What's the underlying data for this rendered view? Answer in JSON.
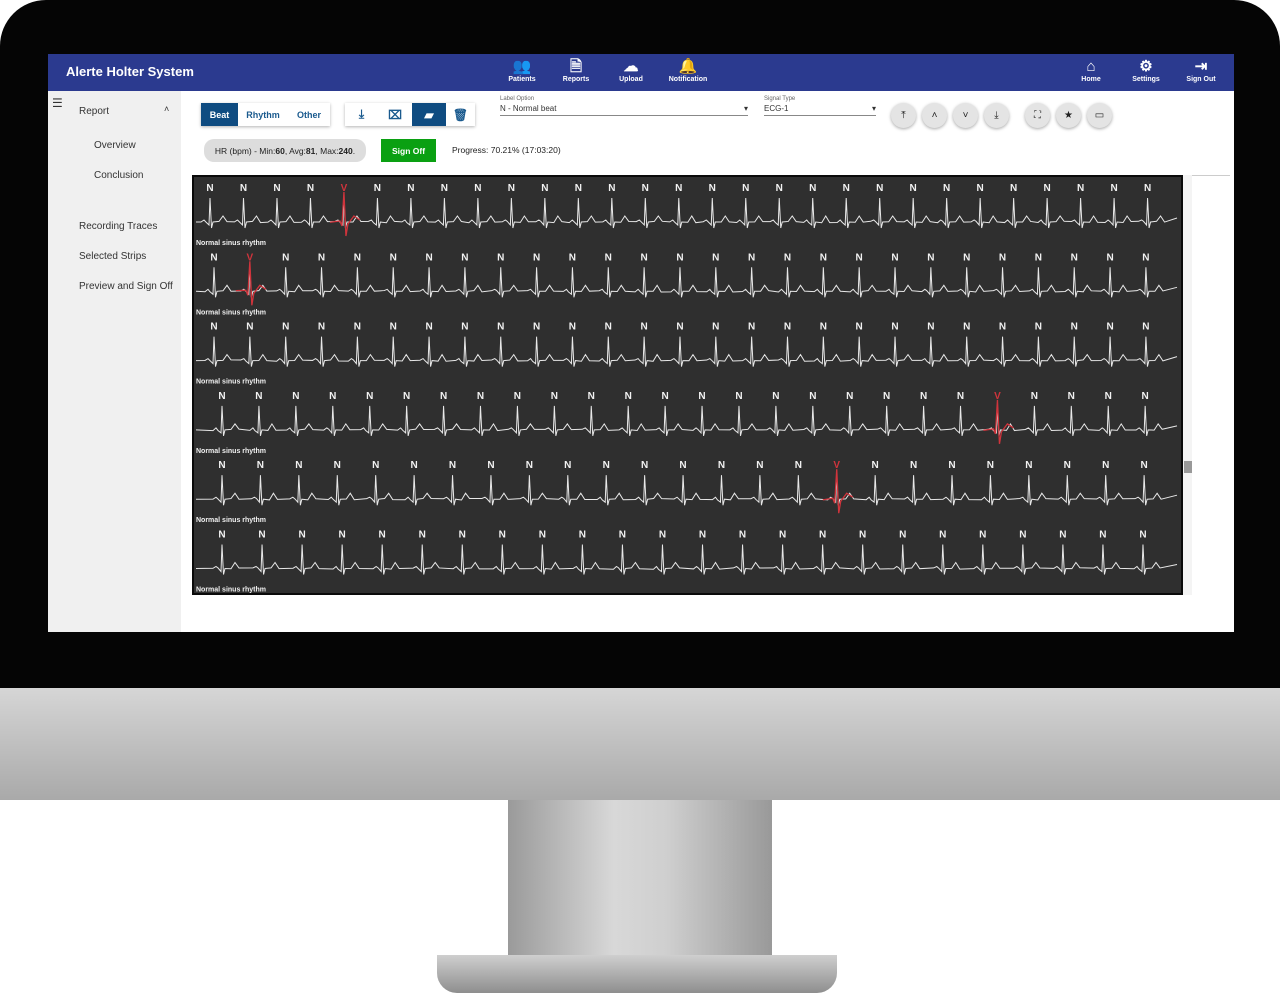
{
  "app": {
    "title": "Alerte Holter System",
    "nav_color": "#2b3a8f"
  },
  "nav": {
    "center": [
      {
        "label": "Patients",
        "icon": "users-icon"
      },
      {
        "label": "Reports",
        "icon": "file-icon"
      },
      {
        "label": "Upload",
        "icon": "cloud-upload-icon"
      },
      {
        "label": "Notification",
        "icon": "bell-icon"
      }
    ],
    "right": [
      {
        "label": "Home",
        "icon": "home-icon"
      },
      {
        "label": "Settings",
        "icon": "gear-icon"
      },
      {
        "label": "Sign Out",
        "icon": "sign-out-icon"
      }
    ]
  },
  "sidebar": {
    "section": "Report",
    "sub": [
      "Overview",
      "Conclusion"
    ],
    "items": [
      "Recording Traces",
      "Selected Strips",
      "Preview and Sign Off"
    ]
  },
  "toolbar": {
    "tabs": [
      "Beat",
      "Rhythm",
      "Other"
    ],
    "active_tab": "Beat",
    "tools": [
      "download-icon",
      "text-select-icon",
      "label-icon",
      "trash-icon"
    ],
    "active_tool": "label-icon",
    "label_option": {
      "label": "Label Option",
      "value": "N - Normal beat"
    },
    "signal_type": {
      "label": "Signal Type",
      "value": "ECG-1"
    },
    "nav_buttons": [
      "first-page-icon",
      "chevron-up-icon",
      "chevron-down-icon",
      "last-page-icon"
    ],
    "view_buttons": [
      "fullscreen-icon",
      "star-icon",
      "ruler-icon"
    ]
  },
  "status": {
    "hr_prefix": "HR (bpm) - Min: ",
    "min": "60",
    "avg_label": ", Avg: ",
    "avg": "81",
    "max_label": ", Max: ",
    "max": "240",
    "hr_suffix": ".",
    "sign_off": "Sign Off",
    "progress": "Progress: 70.21% (17:03:20)"
  },
  "ecg": {
    "background": "#2f2f2f",
    "trace_color": "#e8e8e8",
    "abnormal_color": "#d0343c",
    "strips": [
      {
        "rhythm": "Normal sinus rhythm",
        "beats": [
          "N",
          "N",
          "N",
          "N",
          "V",
          "N",
          "N",
          "N",
          "N",
          "N",
          "N",
          "N",
          "N",
          "N",
          "N",
          "N",
          "N",
          "N",
          "N",
          "N",
          "N",
          "N",
          "N",
          "N",
          "N",
          "N",
          "N",
          "N",
          "N"
        ]
      },
      {
        "rhythm": "Normal sinus rhythm",
        "beats": [
          "N",
          "V",
          "N",
          "N",
          "N",
          "N",
          "N",
          "N",
          "N",
          "N",
          "N",
          "N",
          "N",
          "N",
          "N",
          "N",
          "N",
          "N",
          "N",
          "N",
          "N",
          "N",
          "N",
          "N",
          "N",
          "N",
          "N"
        ]
      },
      {
        "rhythm": "Normal sinus rhythm",
        "beats": [
          "N",
          "N",
          "N",
          "N",
          "N",
          "N",
          "N",
          "N",
          "N",
          "N",
          "N",
          "N",
          "N",
          "N",
          "N",
          "N",
          "N",
          "N",
          "N",
          "N",
          "N",
          "N",
          "N",
          "N",
          "N",
          "N",
          "N"
        ]
      },
      {
        "rhythm": "Normal sinus rhythm",
        "beats": [
          "N",
          "N",
          "N",
          "N",
          "N",
          "N",
          "N",
          "N",
          "N",
          "N",
          "N",
          "N",
          "N",
          "N",
          "N",
          "N",
          "N",
          "N",
          "N",
          "N",
          "N",
          "V",
          "N",
          "N",
          "N",
          "N"
        ]
      },
      {
        "rhythm": "Normal sinus rhythm",
        "beats": [
          "N",
          "N",
          "N",
          "N",
          "N",
          "N",
          "N",
          "N",
          "N",
          "N",
          "N",
          "N",
          "N",
          "N",
          "N",
          "N",
          "V",
          "N",
          "N",
          "N",
          "N",
          "N",
          "N",
          "N",
          "N"
        ]
      },
      {
        "rhythm": "Normal sinus rhythm",
        "beats": [
          "N",
          "N",
          "N",
          "N",
          "N",
          "N",
          "N",
          "N",
          "N",
          "N",
          "N",
          "N",
          "N",
          "N",
          "N",
          "N",
          "N",
          "N",
          "N",
          "N",
          "N",
          "N",
          "N",
          "N"
        ]
      }
    ]
  }
}
